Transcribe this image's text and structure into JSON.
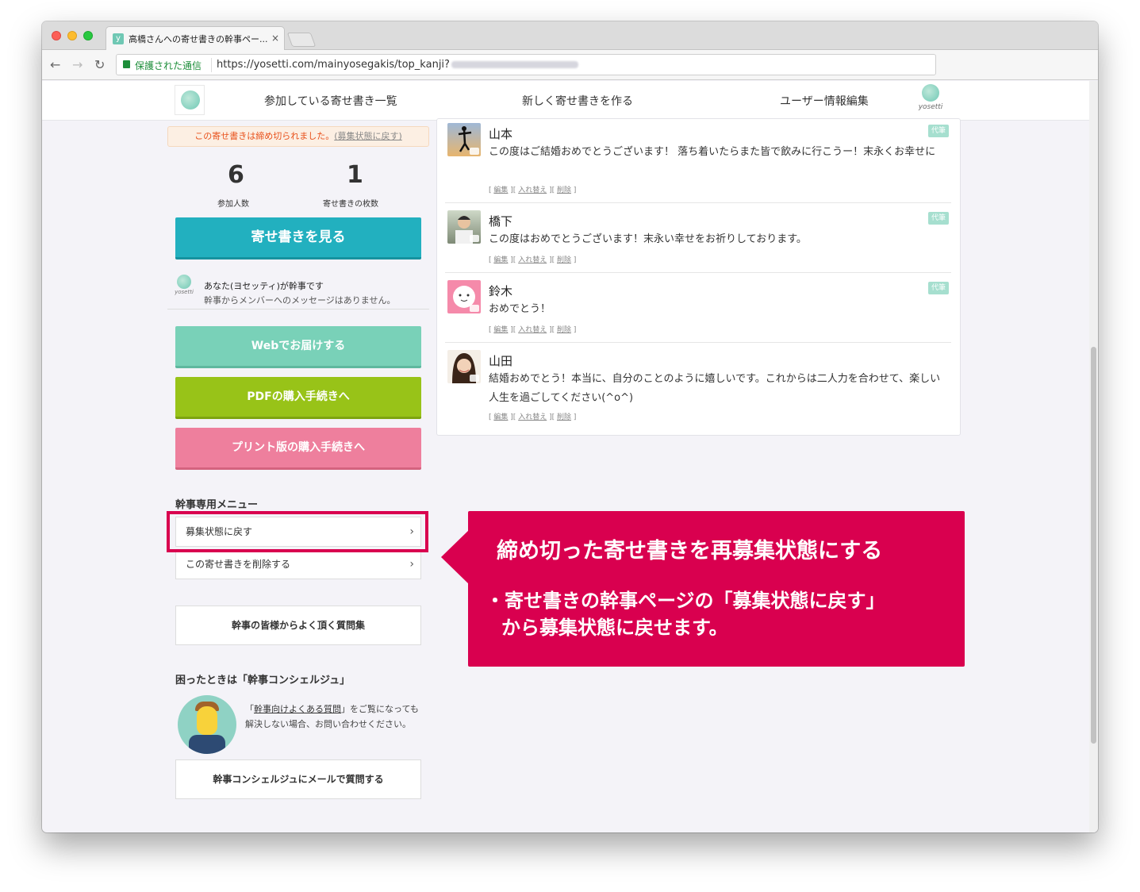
{
  "browser": {
    "tab_title": "高橋さんへの寄せ書きの幹事ペー...",
    "tab_favicon": "y",
    "tab_close": "×",
    "secure_label": "保護された通信",
    "url": "https://yosetti.com/mainyosegakis/top_kanji?"
  },
  "header": {
    "nav": [
      "参加している寄せ書き一覧",
      "新しく寄せ書きを作る",
      "ユーザー情報編集"
    ],
    "logo_word": "yosetti"
  },
  "sidebar": {
    "closed_notice": "この寄せ書きは締め切られました。",
    "reopen_link": "(募集状態に戻す)",
    "stats": [
      {
        "value": "6",
        "label": "参加人数"
      },
      {
        "value": "1",
        "label": "寄せ書きの枚数"
      }
    ],
    "view_button": "寄せ書きを見る",
    "kanji": {
      "logo_word": "yosetti",
      "line1": "あなた(ヨセッティ)が幹事です",
      "line2": "幹事からメンバーへのメッセージはありません。"
    },
    "web_button": "Webでお届けする",
    "pdf_button": "PDFの購入手続きへ",
    "print_button": "プリント版の購入手続きへ",
    "menu_title": "幹事専用メニュー",
    "menu_items": [
      "募集状態に戻す",
      "この寄せ書きを削除する"
    ],
    "chevron": "›",
    "faq_button": "幹事の皆様からよく頂く質問集",
    "concierge": {
      "title": "困ったときは「幹事コンシェルジュ」",
      "text_pre": "「",
      "text_link": "幹事向けよくある質問",
      "text_post": "」をご覧になっても解決しない場合、お問い合わせください。",
      "mail_button": "幹事コンシェルジュにメールで質問する"
    }
  },
  "messages": [
    {
      "name": "山本",
      "body": "この度はご結婚おめでとうございます！ 落ち着いたらまた皆で飲みに行こうー！末永くお幸せに",
      "badge": "代筆",
      "avatar": "silhouette-jump"
    },
    {
      "name": "橋下",
      "body": "この度はおめでとうございます！末永い幸せをお祈りしております。",
      "badge": "代筆",
      "avatar": "man-photo"
    },
    {
      "name": "鈴木",
      "body": "おめでとう！",
      "badge": "代筆",
      "avatar": "pink-face"
    },
    {
      "name": "山田",
      "body": "結婚おめでとう！本当に、自分のことのように嬉しいです。これからは二人力を合わせて、楽しい人生を過ごしてください(^o^)",
      "badge": "",
      "avatar": "woman-photo"
    }
  ],
  "message_actions": {
    "open": "[",
    "sep": "][",
    "close": "]",
    "edit": "編集",
    "swap": "入れ替え",
    "delete": "削除"
  },
  "callout": {
    "title": "締め切った寄せ書きを再募集状態にする",
    "bullet_line1": "・寄せ書きの幹事ページの「募集状態に戻す」",
    "bullet_line2": "から募集状態に戻せます。",
    "color": "#d9004f"
  },
  "colors": {
    "teal": "#22b0bf",
    "mint": "#79d1b8",
    "green": "#98c318",
    "pink": "#ee7f9d",
    "highlight": "#d9004f"
  }
}
